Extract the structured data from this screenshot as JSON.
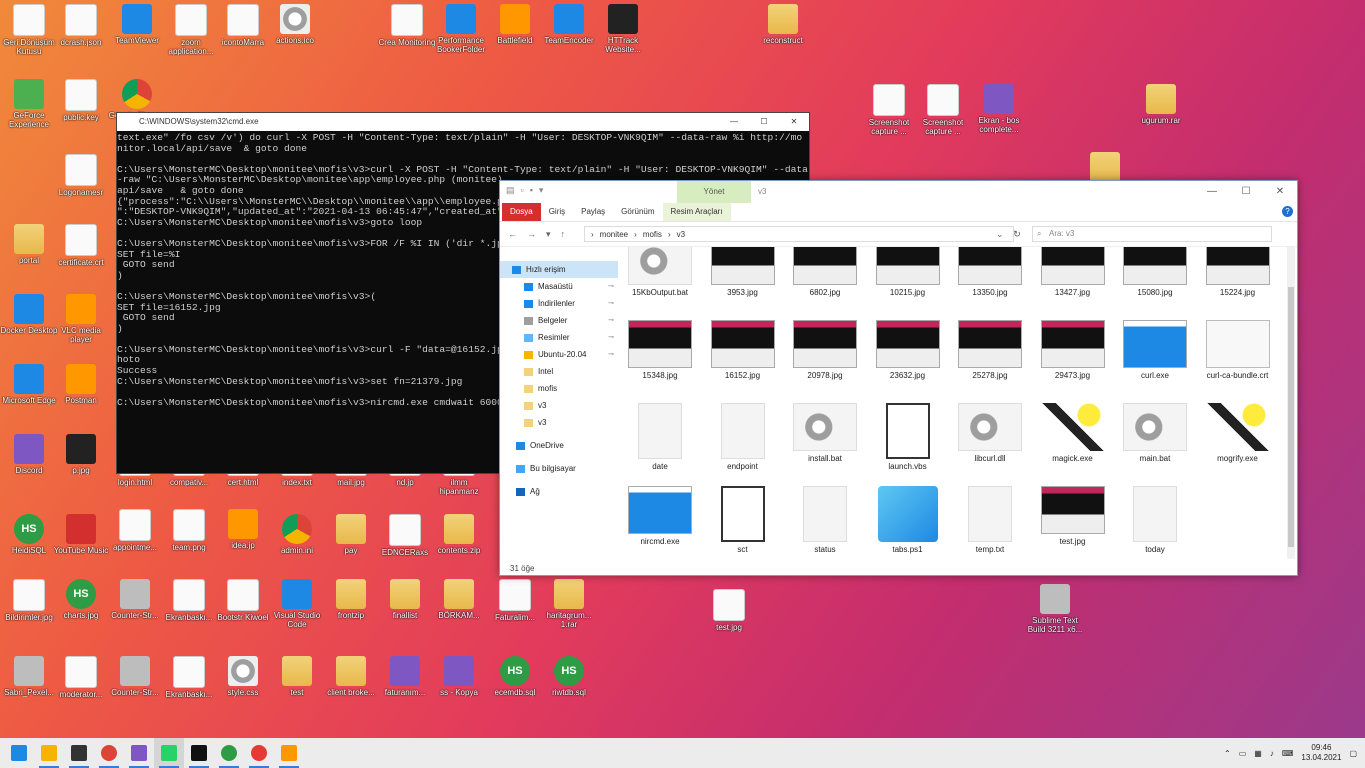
{
  "desktop": {
    "icons": [
      {
        "label": "Geri Dönüşüm Kutusu",
        "icon": "recycle-bin-icon"
      },
      {
        "label": "dcrash.json",
        "icon": "file-icon"
      },
      {
        "label": "TeamViewer",
        "icon": "teamviewer-icon"
      },
      {
        "label": "zoom application...",
        "icon": "file-icon"
      },
      {
        "label": "icontoMarra",
        "icon": "screenshot-icon"
      },
      {
        "label": "actions.ico",
        "icon": "gear-file-icon"
      },
      {
        "label": "Crea Monitoring",
        "icon": "doc-icon"
      },
      {
        "label": "Performance BookerFolder",
        "icon": "app-icon"
      },
      {
        "label": "Battlefield",
        "icon": "game-icon"
      },
      {
        "label": "TeamEncoder",
        "icon": "app-icon"
      },
      {
        "label": "HTTrack Website...",
        "icon": "httrack-icon"
      },
      {
        "label": "reconstruct",
        "icon": "folder-icon"
      },
      {
        "label": "GeForce Experience",
        "icon": "nvidia-icon"
      },
      {
        "label": "public.key",
        "icon": "file-icon"
      },
      {
        "label": "Google Chrome",
        "icon": "chrome-icon"
      },
      {
        "label": "Logonamesr",
        "icon": "certificate-icon"
      },
      {
        "label": "portal",
        "icon": "folder-icon"
      },
      {
        "label": "certificate.crt",
        "icon": "certificate-icon"
      },
      {
        "label": "Docker Desktop",
        "icon": "docker-icon"
      },
      {
        "label": "VLC media player",
        "icon": "vlc-icon"
      },
      {
        "label": "Microsoft Edge",
        "icon": "edge-icon"
      },
      {
        "label": "Postman",
        "icon": "postman-icon"
      },
      {
        "label": "Discord",
        "icon": "discord-icon"
      },
      {
        "label": "p.jpg",
        "icon": "image-icon"
      },
      {
        "label": "HeidiSQL",
        "icon": "heidisql-icon"
      },
      {
        "label": "YouTube Music",
        "icon": "youtube-music-icon"
      },
      {
        "label": "appointme...",
        "icon": "file-icon"
      },
      {
        "label": "team.png",
        "icon": "screenshot-icon"
      },
      {
        "label": "idea.jp",
        "icon": "sublime-icon"
      },
      {
        "label": "admin.ini",
        "icon": "chrome-icon"
      },
      {
        "label": "pay",
        "icon": "zip-icon"
      },
      {
        "label": "EDNCERaxs",
        "icon": "file-icon"
      },
      {
        "label": "contents.zip",
        "icon": "zip-icon"
      },
      {
        "label": "Bildirimler.jpg",
        "icon": "file-icon"
      },
      {
        "label": "charts.jpg",
        "icon": "heidisql-icon"
      },
      {
        "label": "Counter-Str...",
        "icon": "csgo-icon"
      },
      {
        "label": "Ekranbaskı...",
        "icon": "screenshot-icon"
      },
      {
        "label": "Bootstr Kiwoel",
        "icon": "file-icon"
      },
      {
        "label": "Visual Studio Code",
        "icon": "vscode-icon"
      },
      {
        "label": "frontzip",
        "icon": "zip-icon"
      },
      {
        "label": "finallist",
        "icon": "zip-icon"
      },
      {
        "label": "BÖRKAM...",
        "icon": "zip-icon"
      },
      {
        "label": "Faturalim...",
        "icon": "file-icon"
      },
      {
        "label": "haritagrum... 1.rar",
        "icon": "zip-icon"
      },
      {
        "label": "Sabri_Pexel...",
        "icon": "photo-icon"
      },
      {
        "label": "moderator...",
        "icon": "screenshot-icon"
      },
      {
        "label": "Counter-Str...",
        "icon": "csgo-icon"
      },
      {
        "label": "Ekranbaskı...",
        "icon": "screenshot-icon"
      },
      {
        "label": "style.css",
        "icon": "gear-file-icon"
      },
      {
        "label": "test",
        "icon": "zip-icon"
      },
      {
        "label": "client broke...",
        "icon": "zip-icon"
      },
      {
        "label": "faturanım...",
        "icon": "rar-icon"
      },
      {
        "label": "ss - Kopya",
        "icon": "rar-icon"
      },
      {
        "label": "ecemdb.sql",
        "icon": "heidisql-icon"
      },
      {
        "label": "riwtdb.sql",
        "icon": "heidisql-icon"
      },
      {
        "label": "Screenshot capture ...",
        "icon": "screenshot-icon"
      },
      {
        "label": "Screenshot capture ...",
        "icon": "screenshot-icon"
      },
      {
        "label": "Ekran - bos complete...",
        "icon": "rar-icon"
      },
      {
        "label": "ugurum.rar",
        "icon": "zip-icon"
      },
      {
        "label": "test.jpg",
        "icon": "screenshot-icon"
      },
      {
        "label": "Sublime Text Build 3211 x6...",
        "icon": "sublime-setup-icon"
      },
      {
        "label": "1.0zip",
        "icon": "zip-icon"
      },
      {
        "label": "login.html",
        "icon": "file-icon"
      },
      {
        "label": "compativ...",
        "icon": "file-icon"
      },
      {
        "label": "cert.html",
        "icon": "file-icon"
      },
      {
        "label": "index.txt",
        "icon": "file-icon"
      },
      {
        "label": "mail.jpg",
        "icon": "file-icon"
      },
      {
        "label": "nd.jp",
        "icon": "file-icon"
      },
      {
        "label": "ilmm hipanmanz",
        "icon": "file-icon"
      }
    ]
  },
  "cmd": {
    "title": "C:\\WINDOWS\\system32\\cmd.exe",
    "lines": [
      "text.exe\" /fo csv /v') do curl -X POST -H \"Content-Type: text/plain\" -H \"User: DESKTOP-VNK9QIM\" --data-raw %i http://mo",
      "nitor.local/api/save  & goto done",
      "",
      "C:\\Users\\MonsterMC\\Desktop\\monitee\\mofis\\v3>curl -X POST -H \"Content-Type: text/plain\" -H \"User: DESKTOP-VNK9QIM\" --data",
      "-raw \"C:\\Users\\MonsterMC\\Desktop\\monitee\\app\\employee.php (monitee)",
      "api/save   & goto done",
      "{\"process\":\"C:\\\\Users\\\\MonsterMC\\\\Desktop\\\\monitee\\\\app\\\\employee.p",
      "\":\"DESKTOP-VNK9QIM\",\"updated_at\":\"2021-04-13 06:45:47\",\"created_at\"",
      "C:\\Users\\MonsterMC\\Desktop\\monitee\\mofis\\v3>goto loop",
      "",
      "C:\\Users\\MonsterMC\\Desktop\\monitee\\mofis\\v3>FOR /F %I IN ('dir *.jpg",
      "SET file=%I",
      " GOTO send",
      ")",
      "",
      "C:\\Users\\MonsterMC\\Desktop\\monitee\\mofis\\v3>(",
      "SET file=16152.jpg",
      " GOTO send",
      ")",
      "",
      "C:\\Users\\MonsterMC\\Desktop\\monitee\\mofis\\v3>curl -F \"data=@16152.jp",
      "hoto",
      "Success",
      "C:\\Users\\MonsterMC\\Desktop\\monitee\\mofis\\v3>set fn=21379.jpg",
      "",
      "C:\\Users\\MonsterMC\\Desktop\\monitee\\mofis\\v3>nircmd.exe cmdwait 6000"
    ]
  },
  "explorer": {
    "context_tab": "Yönet",
    "title": "v3",
    "tabs": [
      "Dosya",
      "Giriş",
      "Paylaş",
      "Görünüm",
      "Resim Araçları"
    ],
    "path": [
      "monitee",
      "mofis",
      "v3"
    ],
    "search_placeholder": "Ara: v3",
    "nav": [
      {
        "label": "Hızlı erişim",
        "pin": false
      },
      {
        "label": "Masaüstü",
        "pin": true
      },
      {
        "label": "İndirilenler",
        "pin": true
      },
      {
        "label": "Belgeler",
        "pin": true
      },
      {
        "label": "Resimler",
        "pin": true
      },
      {
        "label": "Ubuntu-20.04",
        "pin": true
      },
      {
        "label": "Intel",
        "pin": false
      },
      {
        "label": "mofis",
        "pin": false
      },
      {
        "label": "v3",
        "pin": false
      },
      {
        "label": "v3",
        "pin": false
      },
      {
        "label": "OneDrive",
        "pin": false
      },
      {
        "label": "Bu bilgisayar",
        "pin": false
      },
      {
        "label": "Ağ",
        "pin": false
      }
    ],
    "files": [
      {
        "name": "15KbOutput.bat",
        "kind": "gear"
      },
      {
        "name": "3953.jpg",
        "kind": "shot"
      },
      {
        "name": "6802.jpg",
        "kind": "shot"
      },
      {
        "name": "10215.jpg",
        "kind": "shot"
      },
      {
        "name": "13350.jpg",
        "kind": "shot"
      },
      {
        "name": "13427.jpg",
        "kind": "shot"
      },
      {
        "name": "15080.jpg",
        "kind": "shot"
      },
      {
        "name": "15224.jpg",
        "kind": "shot"
      },
      {
        "name": "15348.jpg",
        "kind": "shot"
      },
      {
        "name": "16152.jpg",
        "kind": "shot"
      },
      {
        "name": "20978.jpg",
        "kind": "shot"
      },
      {
        "name": "23632.jpg",
        "kind": "shot"
      },
      {
        "name": "25278.jpg",
        "kind": "shot"
      },
      {
        "name": "29473.jpg",
        "kind": "shot"
      },
      {
        "name": "curl.exe",
        "kind": "blue"
      },
      {
        "name": "curl-ca-bundle.crt",
        "kind": "cert"
      },
      {
        "name": "date",
        "kind": "doc"
      },
      {
        "name": "endpoint",
        "kind": "doc"
      },
      {
        "name": "install.bat",
        "kind": "gear"
      },
      {
        "name": "launch.vbs",
        "kind": "script"
      },
      {
        "name": "libcurl.dll",
        "kind": "gear"
      },
      {
        "name": "magick.exe",
        "kind": "wand"
      },
      {
        "name": "main.bat",
        "kind": "gear"
      },
      {
        "name": "mogrify.exe",
        "kind": "wand"
      },
      {
        "name": "nircmd.exe",
        "kind": "blue"
      },
      {
        "name": "sct",
        "kind": "script"
      },
      {
        "name": "status",
        "kind": "doc"
      },
      {
        "name": "tabs.ps1",
        "kind": "ps"
      },
      {
        "name": "temp.txt",
        "kind": "doc"
      },
      {
        "name": "test.jpg",
        "kind": "shot"
      },
      {
        "name": "today",
        "kind": "doc"
      }
    ],
    "status": "31 öğe"
  },
  "taskbar": {
    "apps": [
      "start-icon",
      "file-explorer-icon",
      "terminal-icon",
      "chrome-icon",
      "snipping-icon",
      "whatsapp-icon",
      "cmd-icon",
      "heidisql-icon",
      "youtube-music-icon",
      "sublime-icon"
    ],
    "time": "09:46",
    "date": "13.04.2021"
  }
}
